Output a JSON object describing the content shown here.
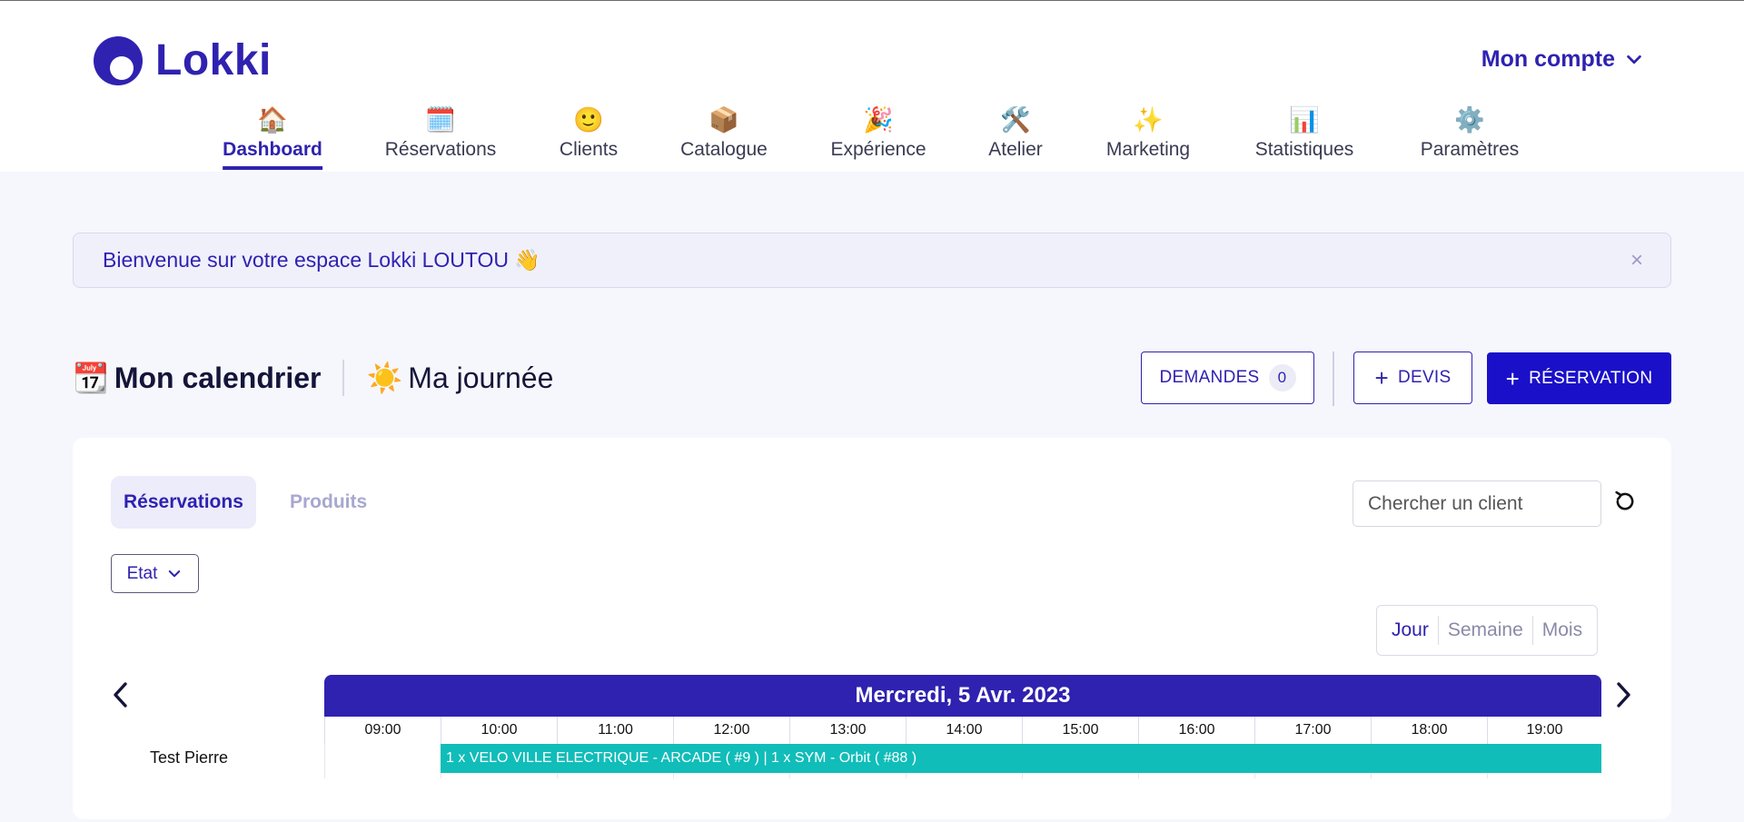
{
  "app": {
    "name": "Lokki"
  },
  "header": {
    "account_label": "Mon compte"
  },
  "nav": [
    {
      "emoji": "🏠",
      "label": "Dashboard",
      "active": true
    },
    {
      "emoji": "🗓️",
      "label": "Réservations"
    },
    {
      "emoji": "🙂",
      "label": "Clients"
    },
    {
      "emoji": "📦",
      "label": "Catalogue"
    },
    {
      "emoji": "🎉",
      "label": "Expérience"
    },
    {
      "emoji": "🛠️",
      "label": "Atelier"
    },
    {
      "emoji": "✨",
      "label": "Marketing"
    },
    {
      "emoji": "📊",
      "label": "Statistiques"
    },
    {
      "emoji": "⚙️",
      "label": "Paramètres"
    }
  ],
  "banner": {
    "text": "Bienvenue sur votre espace Lokki LOUTOU 👋",
    "close": "×"
  },
  "calendar": {
    "title_emoji": "📆",
    "title": "Mon calendrier",
    "my_day_emoji": "☀️",
    "my_day": "Ma journée",
    "demands_label": "DEMANDES",
    "demands_count": "0",
    "quote_label": "DEVIS",
    "reservation_label": "RÉSERVATION"
  },
  "tabs": {
    "reservations": "Réservations",
    "products": "Produits"
  },
  "search": {
    "placeholder": "Chercher un client"
  },
  "filter": {
    "label": "Etat"
  },
  "views": {
    "day": "Jour",
    "week": "Semaine",
    "month": "Mois",
    "active": "Jour"
  },
  "timeline": {
    "date": "Mercredi, 5 Avr. 2023",
    "hours": [
      "09:00",
      "10:00",
      "11:00",
      "12:00",
      "13:00",
      "14:00",
      "15:00",
      "16:00",
      "17:00",
      "18:00",
      "19:00"
    ],
    "rows": [
      {
        "label": "Test Pierre",
        "event": "1 x VELO VILLE ELECTRIQUE - ARCADE ( #9 ) | 1 x SYM - Orbit ( #88 )"
      }
    ]
  },
  "colors": {
    "brand": "#2f22b0",
    "primary": "#1a10c9",
    "event": "#10bdb9"
  }
}
